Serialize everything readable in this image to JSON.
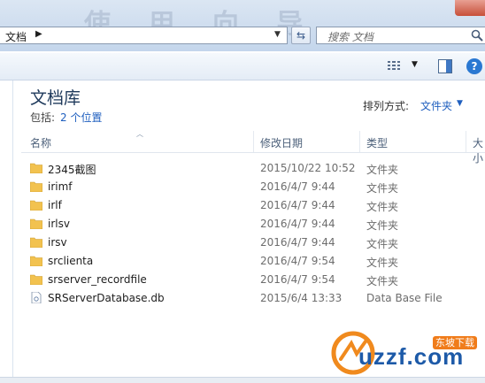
{
  "window": {
    "watermark": "使 用 向 导"
  },
  "address": {
    "segment": "文档"
  },
  "search": {
    "placeholder": "搜索 文档"
  },
  "library": {
    "title": "文档库",
    "includes_label": "包括:",
    "includes_link": "2 个位置",
    "arrange_label": "排列方式:",
    "arrange_value": "文件夹"
  },
  "columns": {
    "name": "名称",
    "modified": "修改日期",
    "type": "类型",
    "size": "大小"
  },
  "files": [
    {
      "name": "2345截图",
      "date": "2015/10/22 10:52",
      "type": "文件夹",
      "icon": "folder-icon"
    },
    {
      "name": "irimf",
      "date": "2016/4/7 9:44",
      "type": "文件夹",
      "icon": "folder-icon"
    },
    {
      "name": "irlf",
      "date": "2016/4/7 9:44",
      "type": "文件夹",
      "icon": "folder-icon"
    },
    {
      "name": "irlsv",
      "date": "2016/4/7 9:44",
      "type": "文件夹",
      "icon": "folder-icon"
    },
    {
      "name": "irsv",
      "date": "2016/4/7 9:44",
      "type": "文件夹",
      "icon": "folder-icon"
    },
    {
      "name": "srclienta",
      "date": "2016/4/7 9:54",
      "type": "文件夹",
      "icon": "folder-icon"
    },
    {
      "name": "srserver_recordfile",
      "date": "2016/4/7 9:54",
      "type": "文件夹",
      "icon": "folder-icon"
    },
    {
      "name": "SRServerDatabase.db",
      "date": "2015/6/4 13:33",
      "type": "Data Base File",
      "icon": "file-icon"
    }
  ],
  "watermark_logo": {
    "tag": "东坡下载",
    "text": "uzzf.com"
  },
  "colors": {
    "link": "#1f5fbf",
    "title": "#1e395b",
    "folder": "#f2c24f"
  }
}
